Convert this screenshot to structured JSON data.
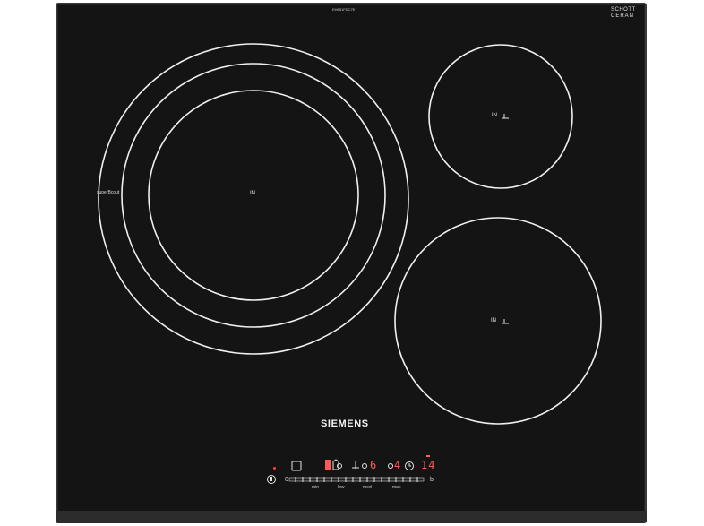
{
  "product": {
    "model_number": "EH651FDC7E",
    "glass_brand_line1": "SCHOTT",
    "glass_brand_line2": "CERAN",
    "glass_brand_line3": "CERAN",
    "brand": "SIEMENS"
  },
  "zones": {
    "large_label": "IN",
    "large_booster_label": "superBcout",
    "top_right_label": "IN",
    "bottom_right_label": "IN"
  },
  "controls": {
    "power_button_label": "",
    "slider_start_label": "0",
    "slider_tick_min": "min",
    "slider_tick_low": "low",
    "slider_tick_med": "med",
    "slider_tick_max": "max",
    "slider_end_label": "b",
    "timer_display": "14",
    "zone_display": "4",
    "zone_display_2": "6"
  },
  "colors": {
    "glass": "#141414",
    "frame": "#3a3a3a",
    "print": "#e6e6e6",
    "indicator_red": "#ff5a5a"
  }
}
